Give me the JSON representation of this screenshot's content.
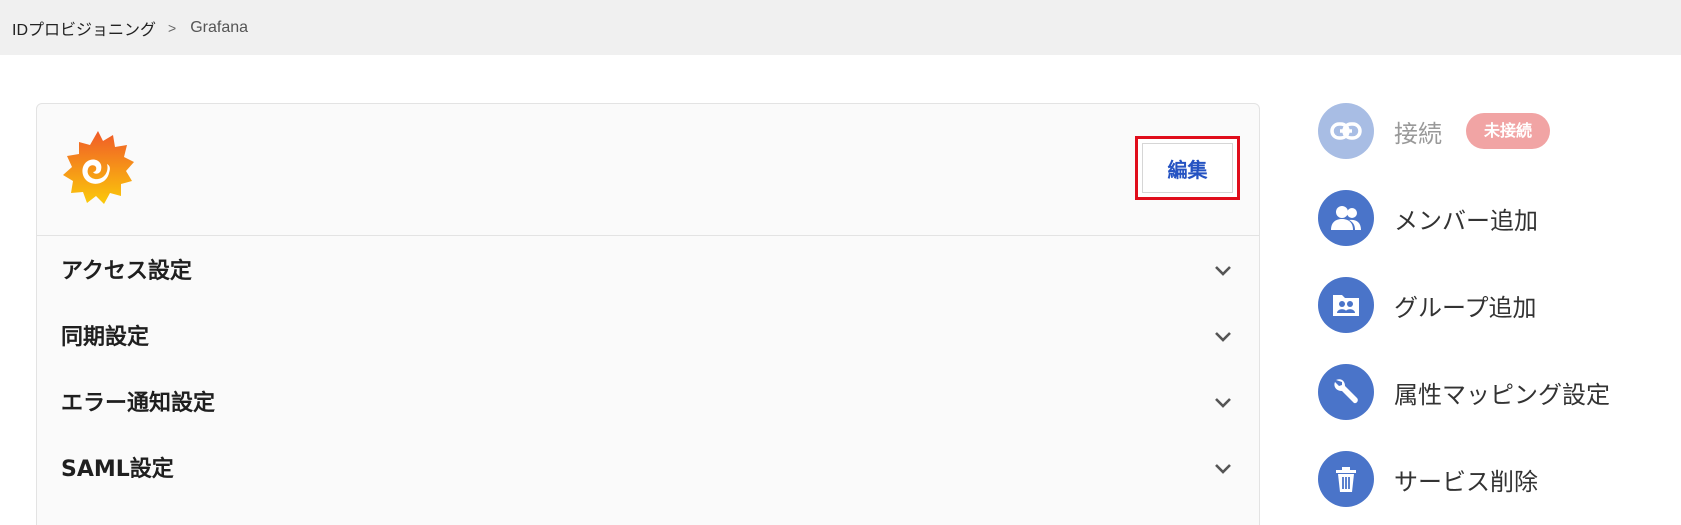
{
  "breadcrumb": {
    "parent": "IDプロビジョニング",
    "separator": ">",
    "current": "Grafana"
  },
  "card": {
    "logo_icon": "grafana-logo",
    "edit_label": "編集",
    "sections": [
      {
        "title": "アクセス設定",
        "icon": "chevron-down-icon"
      },
      {
        "title": "同期設定",
        "icon": "chevron-down-icon"
      },
      {
        "title": "エラー通知設定",
        "icon": "chevron-down-icon"
      },
      {
        "title": "SAML設定",
        "icon": "chevron-down-icon"
      }
    ]
  },
  "sidebar": {
    "connect": {
      "label": "接続",
      "badge": "未接続",
      "icon": "link-icon"
    },
    "add_member": {
      "label": "メンバー追加",
      "icon": "users-icon"
    },
    "add_group": {
      "label": "グループ追加",
      "icon": "group-folder-icon"
    },
    "attribute_mapping": {
      "label": "属性マッピング設定",
      "icon": "wrench-icon"
    },
    "delete_service": {
      "label": "サービス削除",
      "icon": "trash-icon"
    }
  },
  "colors": {
    "accent": "#4a74c9",
    "accent_disabled": "#a8bde4",
    "badge": "#f1a4a4",
    "edit_text": "#2553c2",
    "highlight_border": "#e00d1b"
  }
}
